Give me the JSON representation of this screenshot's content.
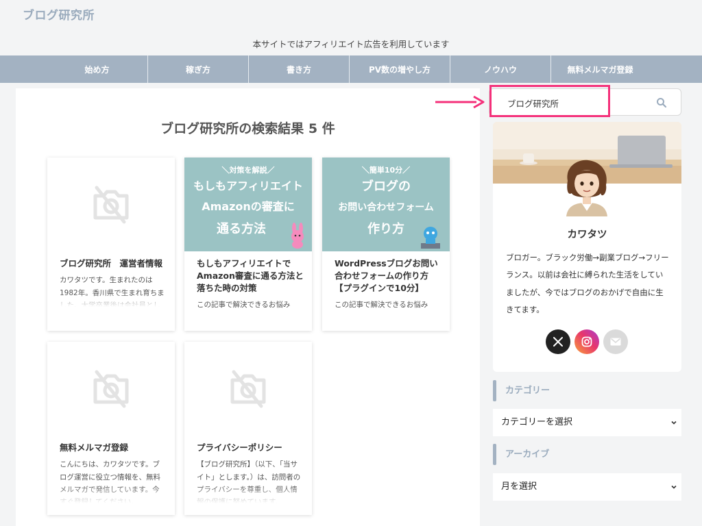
{
  "site": {
    "title": "ブログ研究所",
    "notice": "本サイトではアフィリエイト広告を利用しています"
  },
  "nav": [
    {
      "label": "始め方"
    },
    {
      "label": "稼ぎ方"
    },
    {
      "label": "書き方"
    },
    {
      "label": "PV数の増やし方"
    },
    {
      "label": "ノウハウ"
    },
    {
      "label": "無料メルマガ登録"
    }
  ],
  "results": {
    "heading": "ブログ研究所の検索結果 5 件",
    "cards": [
      {
        "thumb": "no-image-icon",
        "title": "ブログ研究所　運営者情報",
        "excerpt": "カワタツです。生まれたのは1982年。香川県で生まれ育ちました。大学卒業後は会社員として"
      },
      {
        "thumb": "teal",
        "thumb_sub": "＼対策を解説／",
        "thumb_l1": "もしもアフィリエイト",
        "thumb_l2": "Amazonの審査に",
        "thumb_l3": "通る方法",
        "title": "もしもアフィリエイトでAmazon審査に通る方法と落ちた時の対策",
        "excerpt": "この記事で解決できるお悩み"
      },
      {
        "thumb": "teal",
        "thumb_sub": "＼簡単10分／",
        "thumb_l1": "ブログの",
        "thumb_l2": "お問い合わせフォーム",
        "thumb_l3": "作り方",
        "title": "WordPressブログお問い合わせフォームの作り方【プラグインで10分】",
        "excerpt": "この記事で解決できるお悩み"
      },
      {
        "thumb": "no-image-icon",
        "title": "無料メルマガ登録",
        "excerpt": "こんにちは、カワタツです。ブログ運営に役立つ情報を、無料メルマガで発信しています。今すぐ登録してください。"
      },
      {
        "thumb": "no-image-icon",
        "title": "プライバシーポリシー",
        "excerpt": "【ブログ研究所】（以下、「当サイト」とします。）は、訪問者のプライバシーを尊重し、個人情報の保護に努めています。"
      }
    ]
  },
  "search": {
    "value": "ブログ研究所"
  },
  "profile": {
    "name": "カワタツ",
    "bio": "ブロガー。ブラック労働→副業ブログ→フリーランス。以前は会社に縛られた生活をしていましたが、今ではブログのおかげで自由に生きてます。",
    "sns": [
      "x-icon",
      "instagram-icon",
      "mail-icon"
    ]
  },
  "widgets": {
    "category_title": "カテゴリー",
    "category_select": "カテゴリーを選択",
    "archive_title": "アーカイブ",
    "archive_select": "月を選択"
  },
  "colors": {
    "accent": "#a3b2c2",
    "highlight": "#f4307a",
    "teal": "#9bc3c4"
  }
}
